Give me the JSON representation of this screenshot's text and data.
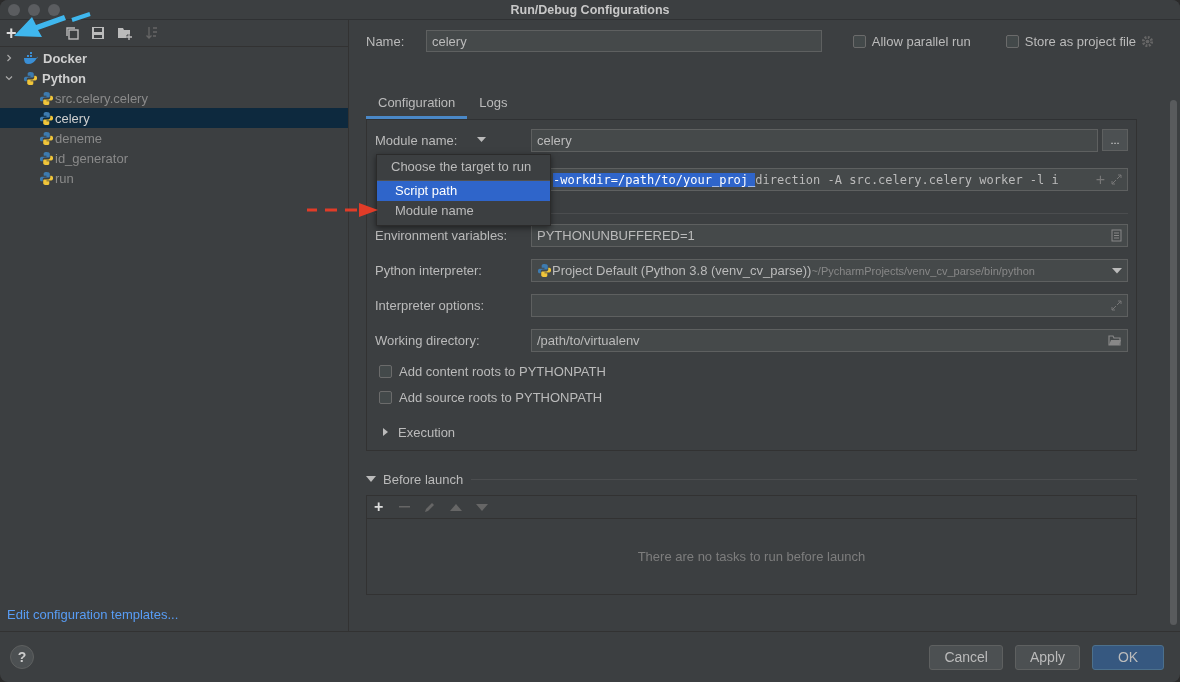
{
  "window": {
    "title": "Run/Debug Configurations"
  },
  "toolbar": {
    "add": "+"
  },
  "tree": [
    {
      "label": "Docker",
      "kind": "docker",
      "expanded": false,
      "selected": false
    },
    {
      "label": "Python",
      "kind": "python",
      "expanded": true,
      "selected": false,
      "children": [
        {
          "label": "src.celery.celery",
          "selected": false
        },
        {
          "label": "celery",
          "selected": true
        },
        {
          "label": "deneme",
          "selected": false
        },
        {
          "label": "id_generator",
          "selected": false
        },
        {
          "label": "run",
          "selected": false
        }
      ]
    }
  ],
  "edit_templates_link": "Edit configuration templates...",
  "help": "?",
  "name": {
    "label": "Name:",
    "value": "celery"
  },
  "options": [
    {
      "label": "Allow parallel run",
      "checked": false
    },
    {
      "label": "Store as project file",
      "checked": false
    }
  ],
  "tabs": [
    {
      "label": "Configuration",
      "selected": true
    },
    {
      "label": "Logs",
      "selected": false
    }
  ],
  "target": {
    "label": "Module name:",
    "value": "celery",
    "browse": "..."
  },
  "params": {
    "selected_text": "-workdir=/path/to/your_proj_",
    "text": "direction -A src.celery.celery worker -l i",
    "add": "+"
  },
  "popup": {
    "title": "Choose the target to run",
    "items": [
      {
        "label": "Script path",
        "selected": true
      },
      {
        "label": "Module name",
        "selected": false
      }
    ]
  },
  "fields": [
    {
      "label": "Environment variables:",
      "kind": "env",
      "value": "PYTHONUNBUFFERED=1"
    },
    {
      "label": "Python interpreter:",
      "kind": "interpreter",
      "value": "Project Default (Python 3.8 (venv_cv_parse))",
      "hint": "~/PycharmProjects/venv_cv_parse/bin/python"
    },
    {
      "label": "Interpreter options:",
      "kind": "expand"
    },
    {
      "label": "Working directory:",
      "kind": "folder",
      "value": "/path/to/virtualenv"
    }
  ],
  "checkboxes": [
    {
      "label": "Add content roots to PYTHONPATH",
      "checked": false
    },
    {
      "label": "Add source roots to PYTHONPATH",
      "checked": false
    }
  ],
  "execution": {
    "label": "Execution",
    "expanded": false
  },
  "before_launch": {
    "label": "Before launch",
    "expanded": true,
    "add": "+",
    "empty_text": "There are no tasks to run before launch"
  },
  "buttons": [
    {
      "label": "Cancel",
      "kind": "normal"
    },
    {
      "label": "Apply",
      "kind": "normal"
    },
    {
      "label": "OK",
      "kind": "default"
    }
  ]
}
